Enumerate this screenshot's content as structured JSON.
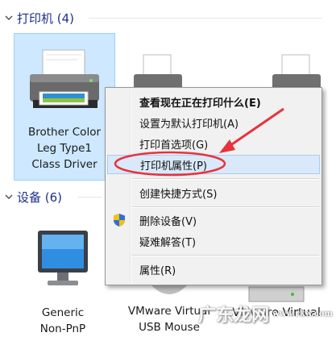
{
  "groups": {
    "printers": {
      "label": "打印机 (4)"
    },
    "devices": {
      "label": "设备 (6)"
    }
  },
  "printers": [
    {
      "lines": [
        "Brother Color",
        "Leg Type1",
        "Class Driver"
      ],
      "selected": true
    }
  ],
  "devices": [
    {
      "lines": [
        "Generic",
        "Non-PnP"
      ]
    },
    {
      "lines": [
        "VMware Virtual",
        "USB Mouse"
      ]
    },
    {
      "lines": [
        "VMware Virtual"
      ]
    }
  ],
  "context_menu": {
    "items": [
      {
        "label": "查看现在正在打印什么(E)",
        "bold": true
      },
      {
        "label": "设置为默认打印机(A)"
      },
      {
        "label": "打印首选项(G)"
      },
      {
        "label": "打印机属性(P)",
        "highlighted": true
      },
      {
        "label": "创建快捷方式(S)"
      },
      {
        "label": "删除设备(V)",
        "icon": "uac-shield-icon"
      },
      {
        "label": "疑难解答(T)"
      },
      {
        "label": "属性(R)"
      }
    ]
  },
  "annotation": {
    "color": "#e8323c"
  },
  "watermark": {
    "text": "广东龙网",
    "sub": "www.rkw.com"
  }
}
